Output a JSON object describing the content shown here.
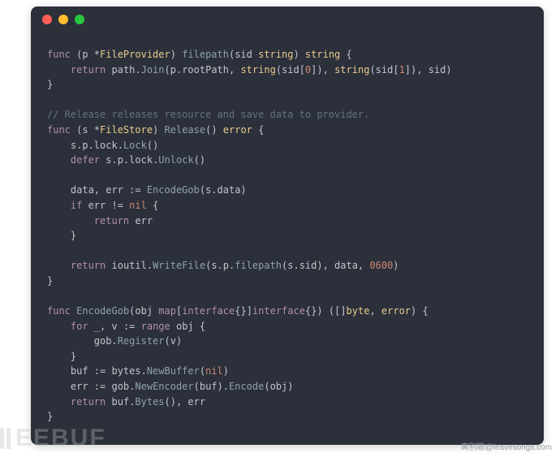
{
  "window": {
    "dots": [
      "red",
      "yellow",
      "green"
    ]
  },
  "code": {
    "l1_func": "func",
    "l1_recv_open": " (p *",
    "l1_type1": "FileProvider",
    "l1_recv_close": ") ",
    "l1_fn": "filepath",
    "l1_params_open": "(sid ",
    "l1_string": "string",
    "l1_params_close": ") ",
    "l1_ret": "string",
    "l1_brace": " {",
    "l2_indent": "    ",
    "l2_return": "return",
    "l2_sp": " path.",
    "l2_join": "Join",
    "l2_open": "(p.rootPath, ",
    "l2_string1": "string",
    "l2_idx1_open": "(sid[",
    "l2_zero": "0",
    "l2_idx1_close": "]), ",
    "l2_string2": "string",
    "l2_idx2_open": "(sid[",
    "l2_one": "1",
    "l2_idx2_close": "]), sid)",
    "l3": "}",
    "l5_comment": "// Release releases resource and save data to provider.",
    "l6_func": "func",
    "l6_recv_open": " (s *",
    "l6_type": "FileStore",
    "l6_recv_close": ") ",
    "l6_fn": "Release",
    "l6_params": "() ",
    "l6_ret": "error",
    "l6_brace": " {",
    "l7_indent": "    ",
    "l7_text": "s.p.lock.",
    "l7_lock": "Lock",
    "l7_close": "()",
    "l8_indent": "    ",
    "l8_defer": "defer",
    "l8_text": " s.p.lock.",
    "l8_unlock": "Unlock",
    "l8_close": "()",
    "l10_indent": "    ",
    "l10_vars": "data, err := ",
    "l10_fn": "EncodeGob",
    "l10_args": "(s.data)",
    "l11_indent": "    ",
    "l11_if": "if",
    "l11_cond": " err != ",
    "l11_nil": "nil",
    "l11_brace": " {",
    "l12_indent": "        ",
    "l12_return": "return",
    "l12_err": " err",
    "l13_indent": "    ",
    "l13": "}",
    "l15_indent": "    ",
    "l15_return": "return",
    "l15_text": " ioutil.",
    "l15_fn": "WriteFile",
    "l15_open": "(s.p.",
    "l15_fp": "filepath",
    "l15_args": "(s.sid), data, ",
    "l15_perm": "0600",
    "l15_close": ")",
    "l16": "}",
    "l18_func": "func",
    "l18_sp": " ",
    "l18_fn": "EncodeGob",
    "l18_open": "(obj ",
    "l18_map": "map",
    "l18_key_open": "[",
    "l18_iface1": "interface",
    "l18_key_close": "{}]",
    "l18_iface2": "interface",
    "l18_close_param": "{}) ([]",
    "l18_byte": "byte",
    "l18_comma": ", ",
    "l18_error": "error",
    "l18_brace": ") {",
    "l19_indent": "    ",
    "l19_for": "for",
    "l19_vars": " _, v := ",
    "l19_range": "range",
    "l19_obj": " obj {",
    "l20_indent": "        ",
    "l20_text": "gob.",
    "l20_fn": "Register",
    "l20_args": "(v)",
    "l21_indent": "    ",
    "l21": "}",
    "l22_indent": "    ",
    "l22_var": "buf := bytes.",
    "l22_fn": "NewBuffer",
    "l22_open": "(",
    "l22_nil": "nil",
    "l22_close": ")",
    "l23_indent": "    ",
    "l23_var": "err := gob.",
    "l23_fn1": "NewEncoder",
    "l23_mid": "(buf).",
    "l23_fn2": "Encode",
    "l23_args": "(obj)",
    "l24_indent": "    ",
    "l24_return": "return",
    "l24_text": " buf.",
    "l24_fn": "Bytes",
    "l24_close": "(), err",
    "l25": "}"
  },
  "watermark": {
    "left": "EEBUF",
    "right": "离别歌@leavesongs.com"
  }
}
